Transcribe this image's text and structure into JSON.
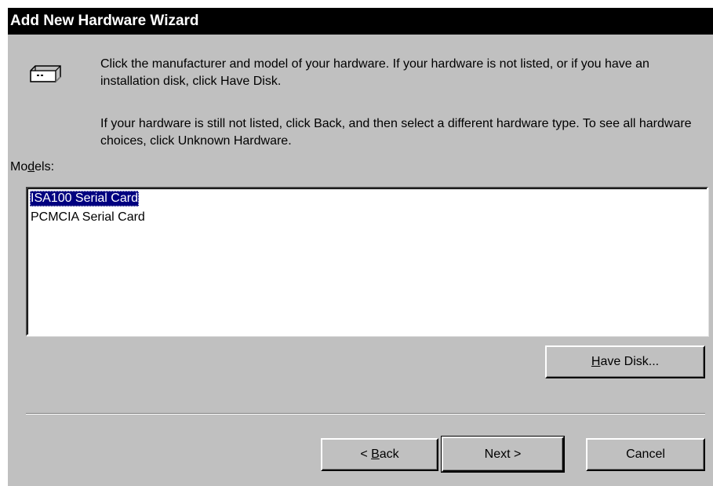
{
  "window": {
    "title": "Add New Hardware Wizard"
  },
  "intro": {
    "icon": "hardware-card-icon",
    "paragraph1": "Click the manufacturer and model of your hardware. If your hardware is not listed, or if you have an installation disk, click Have Disk.",
    "paragraph2": "If your hardware is still not listed, click Back, and then select a different hardware type. To see all hardware choices, click Unknown Hardware."
  },
  "models": {
    "label_pre": "Mo",
    "label_accel": "d",
    "label_post": "els:",
    "items": [
      {
        "label": "ISA100 Serial Card",
        "selected": true
      },
      {
        "label": "PCMCIA Serial Card",
        "selected": false
      }
    ]
  },
  "buttons": {
    "have_disk_accel": "H",
    "have_disk_rest": "ave Disk...",
    "back_prefix": "< ",
    "back_accel": "B",
    "back_rest": "ack",
    "next": "Next >",
    "cancel": "Cancel"
  },
  "colors": {
    "titlebar": "#000000",
    "face": "#c0c0c0",
    "selection": "#000080"
  }
}
